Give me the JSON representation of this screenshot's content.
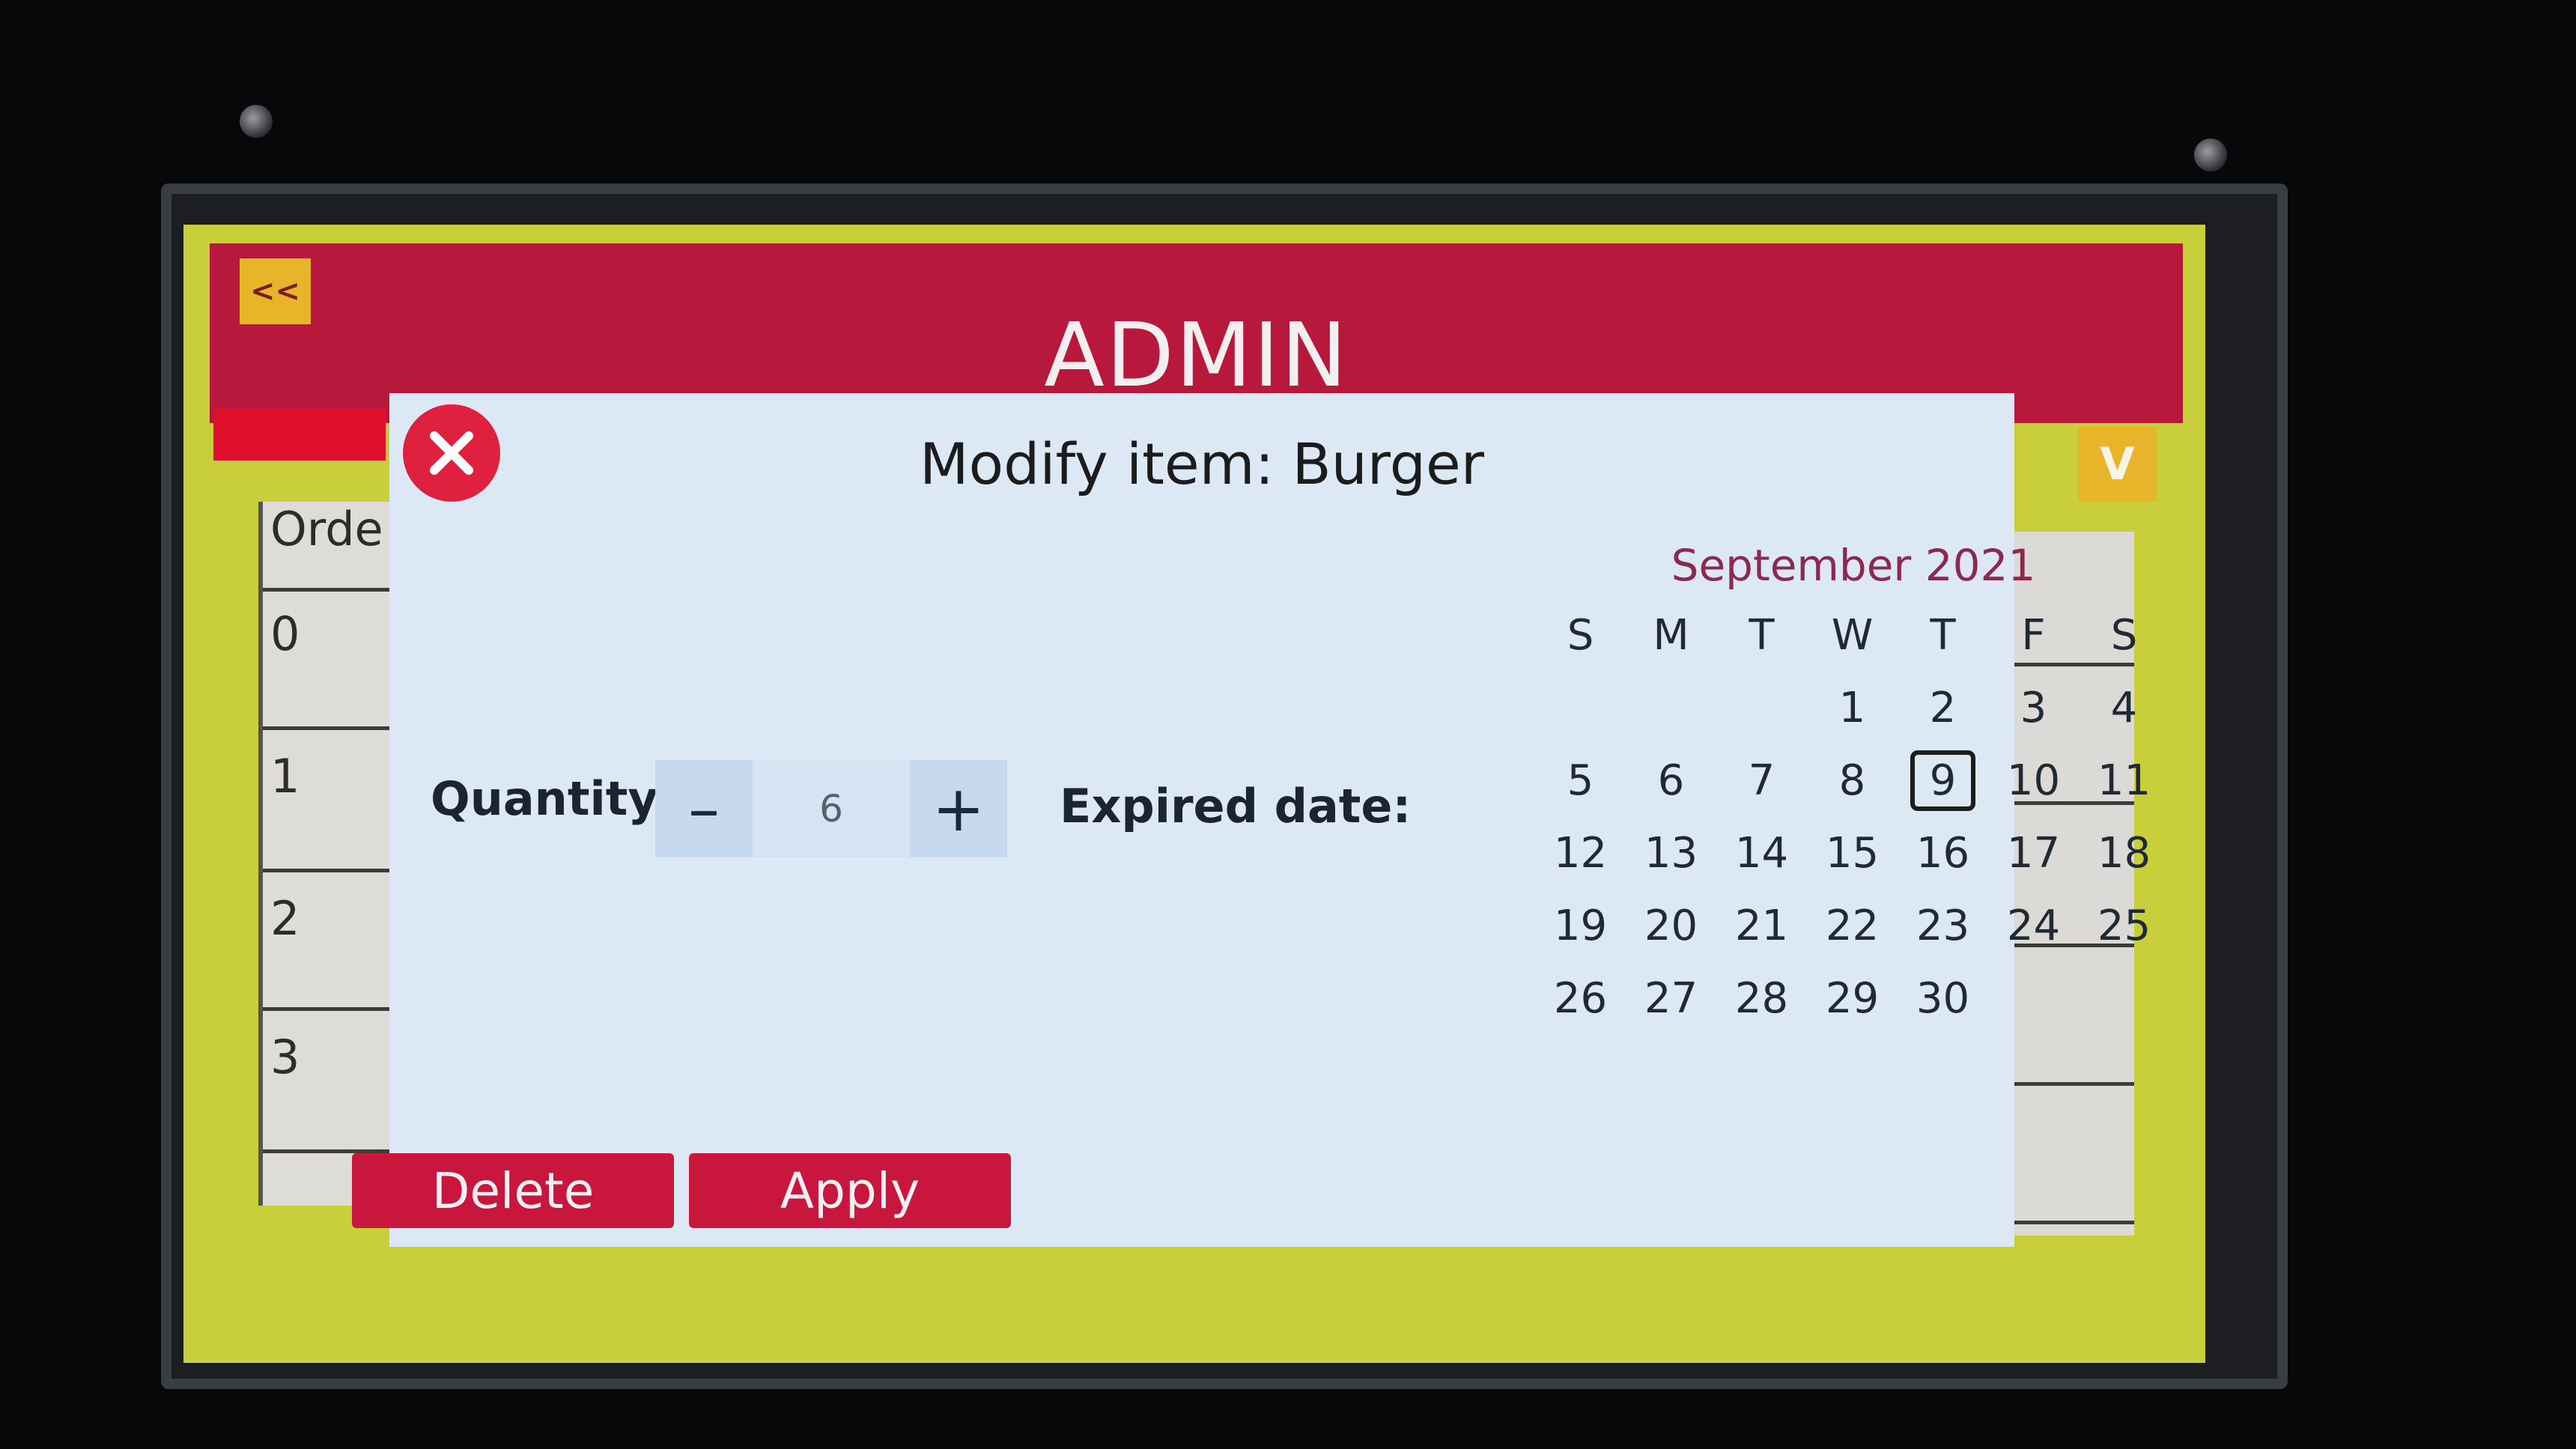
{
  "header": {
    "back_label": "<<",
    "title": "ADMIN"
  },
  "background": {
    "column_header": "Orde",
    "row_labels": [
      "0",
      "1",
      "2",
      "3"
    ],
    "dropdown_label": "V"
  },
  "modal": {
    "title": "Modify item: Burger",
    "quantity_label": "Quantity:",
    "quantity_value": "6",
    "decrement_label": "–",
    "increment_label": "+",
    "expired_label": "Expired date:",
    "delete_label": "Delete",
    "apply_label": "Apply"
  },
  "calendar": {
    "month_label": "September 2021",
    "weekdays": [
      "S",
      "M",
      "T",
      "W",
      "T",
      "F",
      "S"
    ],
    "first_weekday_index": 3,
    "days_in_month": 30,
    "selected_day": 9
  },
  "colors": {
    "header": "#b8183b",
    "screen_background": "#c9cf3b",
    "modal_background": "#dce8f4",
    "accent_button": "#c8163d",
    "close_button": "#e0203f",
    "month_text": "#8a2a4e"
  },
  "icons": {
    "close": "close-icon"
  }
}
